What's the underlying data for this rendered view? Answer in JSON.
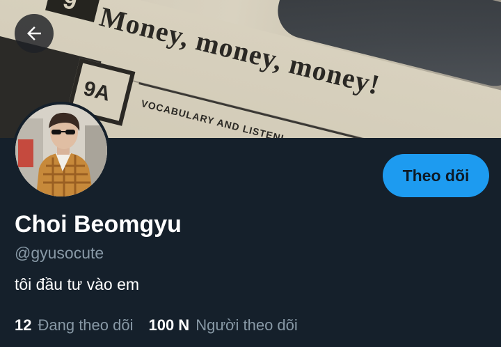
{
  "banner": {
    "headline": "Money, money, money!",
    "unit_number": "9A",
    "top_number": "9",
    "subline": "VOCABULARY AND LISTENI"
  },
  "header": {
    "back_icon": "arrow-left-icon"
  },
  "profile": {
    "display_name": "Choi Beomgyu",
    "handle": "@gyusocute",
    "bio": "tôi đầu tư vào em",
    "follow_label": "Theo dõi",
    "avatar_icon": "profile-photo"
  },
  "stats": {
    "following_count": "12",
    "following_label": "Đang theo dõi",
    "followers_count": "100 N",
    "followers_label": "Người theo dõi"
  },
  "colors": {
    "background": "#15202b",
    "accent": "#1d9bf0",
    "muted_text": "#8899a6",
    "primary_text": "#ffffff"
  }
}
